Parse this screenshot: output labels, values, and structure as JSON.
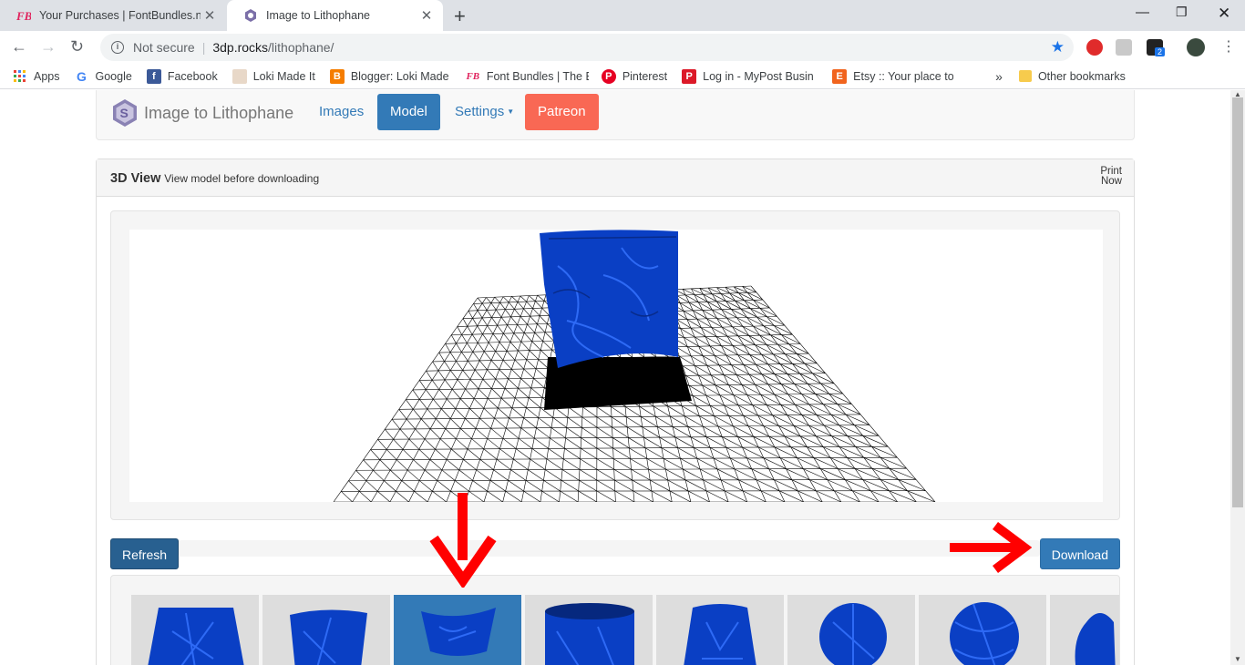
{
  "tabs": [
    {
      "title": "Your Purchases | FontBundles.net",
      "favicon": "fontbundles-icon"
    },
    {
      "title": "Image to Lithophane",
      "favicon": "lithophane-icon"
    }
  ],
  "toolbar": {
    "security": "Not secure",
    "url_host": "3dp.rocks",
    "url_path": "/lithophane/",
    "extension_badge": "2"
  },
  "bookmarks": {
    "items": [
      {
        "label": "Apps",
        "icon": "apps-icon"
      },
      {
        "label": "Google",
        "icon": "google-icon"
      },
      {
        "label": "Facebook",
        "icon": "facebook-icon"
      },
      {
        "label": "Loki Made It",
        "icon": "loki-icon"
      },
      {
        "label": "Blogger: Loki Made It",
        "icon": "blogger-icon"
      },
      {
        "label": "Font Bundles | The Be",
        "icon": "fontbundles-icon"
      },
      {
        "label": "Pinterest",
        "icon": "pinterest-icon"
      },
      {
        "label": "Log in - MyPost Busin",
        "icon": "mypost-icon"
      },
      {
        "label": "Etsy :: Your place to b",
        "icon": "etsy-icon"
      }
    ],
    "overflow": "»",
    "other": "Other bookmarks"
  },
  "nav": {
    "brand": "Image to Lithophane",
    "images": "Images",
    "model": "Model",
    "settings": "Settings",
    "patreon": "Patreon"
  },
  "panel": {
    "title": "3D View",
    "subtitle": "View model before downloading",
    "print": "Print Now"
  },
  "actions": {
    "refresh": "Refresh",
    "download": "Download"
  },
  "colors": {
    "primary": "#337ab7",
    "patreon": "#f96854",
    "model_blue": "#0a3fc4",
    "annotation_red": "#ff0000"
  },
  "shape_thumbnails": [
    {
      "name": "flat-plane",
      "selected": false
    },
    {
      "name": "outer-curve",
      "selected": false
    },
    {
      "name": "inner-curve",
      "selected": true
    },
    {
      "name": "cylinder",
      "selected": false
    },
    {
      "name": "lampshade",
      "selected": false
    },
    {
      "name": "sphere",
      "selected": false
    },
    {
      "name": "globe",
      "selected": false
    },
    {
      "name": "heart",
      "selected": false
    }
  ]
}
